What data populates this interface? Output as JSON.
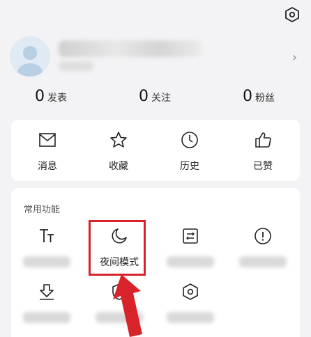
{
  "stats": [
    {
      "num": "0",
      "label": "发表"
    },
    {
      "num": "0",
      "label": "关注"
    },
    {
      "num": "0",
      "label": "粉丝"
    }
  ],
  "quick_actions": [
    {
      "label": "消息",
      "icon": "mail-icon"
    },
    {
      "label": "收藏",
      "icon": "star-icon"
    },
    {
      "label": "历史",
      "icon": "clock-icon"
    },
    {
      "label": "已赞",
      "icon": "thumbs-up-icon"
    }
  ],
  "common_functions": {
    "title": "常用功能",
    "items": [
      {
        "label": "",
        "icon": "text-size-icon"
      },
      {
        "label": "夜间模式",
        "icon": "moon-icon"
      },
      {
        "label": "",
        "icon": "list-edit-icon"
      },
      {
        "label": "",
        "icon": "alert-icon"
      },
      {
        "label": "",
        "icon": "download-icon"
      },
      {
        "label": "",
        "icon": "shield-icon"
      },
      {
        "label": "",
        "icon": "hexagon-settings-icon"
      }
    ]
  },
  "colors": {
    "highlight": "#d8232a",
    "accent_bg": "#f3f3f5"
  }
}
